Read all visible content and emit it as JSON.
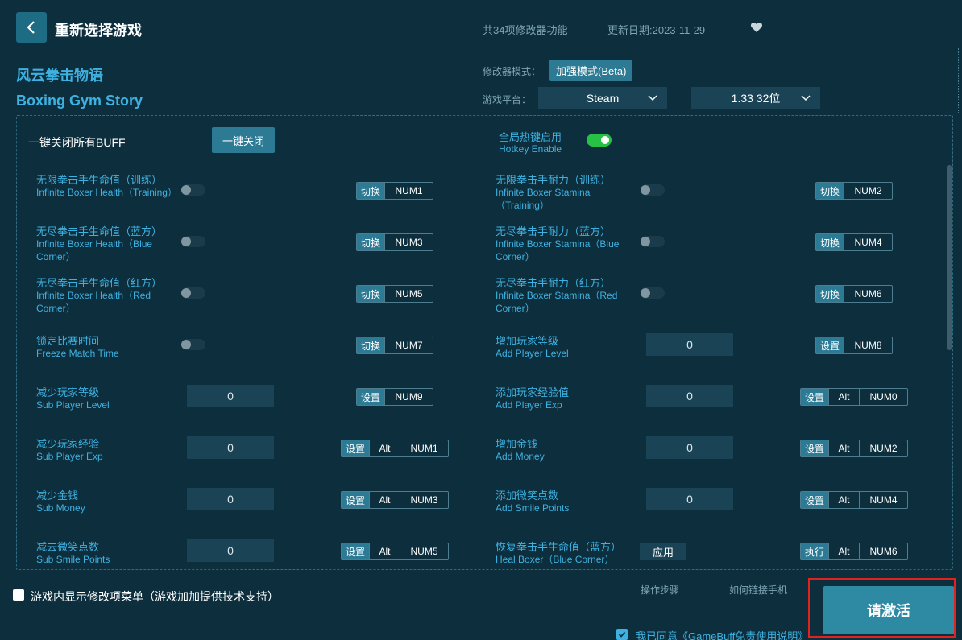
{
  "header": {
    "title": "重新选择游戏",
    "feature_count": "共34项修改器功能",
    "update_date": "更新日期:2023-11-29"
  },
  "game": {
    "name_cn": "风云拳击物语",
    "name_en": "Boxing Gym Story"
  },
  "settings": {
    "mode_label": "修改器模式：",
    "mode_value": "加强模式(Beta)",
    "platform_label": "游戏平台：",
    "platform_value": "Steam",
    "version_value": "1.33 32位"
  },
  "global": {
    "buff_label": "一键关闭所有BUFF",
    "close_all_label": "一键关闭",
    "hotkey_cn": "全局热键启用",
    "hotkey_en": "Hotkey Enable"
  },
  "items": [
    {
      "cn": "无限拳击手生命值（训练）",
      "en": "Infinite Boxer Health（Training）",
      "action": "切换",
      "keys": [
        "NUM1"
      ],
      "value": ""
    },
    {
      "cn": "无限拳击手耐力（训练）",
      "en": "Infinite Boxer Stamina（Training）",
      "action": "切换",
      "keys": [
        "NUM2"
      ],
      "value": ""
    },
    {
      "cn": "无尽拳击手生命值（蓝方）",
      "en": "Infinite Boxer Health（Blue Corner）",
      "action": "切换",
      "keys": [
        "NUM3"
      ],
      "value": ""
    },
    {
      "cn": "无尽拳击手耐力（蓝方）",
      "en": "Infinite Boxer Stamina（Blue Corner）",
      "action": "切换",
      "keys": [
        "NUM4"
      ],
      "value": ""
    },
    {
      "cn": "无尽拳击手生命值（红方）",
      "en": "Infinite Boxer Health（Red Corner）",
      "action": "切换",
      "keys": [
        "NUM5"
      ],
      "value": ""
    },
    {
      "cn": "无尽拳击手耐力（红方）",
      "en": "Infinite Boxer Stamina（Red Corner）",
      "action": "切换",
      "keys": [
        "NUM6"
      ],
      "value": ""
    },
    {
      "cn": "锁定比赛时间",
      "en": "Freeze Match Time",
      "action": "切换",
      "keys": [
        "NUM7"
      ],
      "value": ""
    },
    {
      "cn": "增加玩家等级",
      "en": "Add Player Level",
      "action": "设置",
      "keys": [
        "NUM8"
      ],
      "value": "0"
    },
    {
      "cn": "减少玩家等级",
      "en": "Sub Player Level",
      "action": "设置",
      "keys": [
        "NUM9"
      ],
      "value": "0"
    },
    {
      "cn": "添加玩家经验值",
      "en": "Add Player Exp",
      "action": "设置",
      "keys": [
        "Alt",
        "NUM0"
      ],
      "value": "0"
    },
    {
      "cn": "减少玩家经验",
      "en": "Sub Player Exp",
      "action": "设置",
      "keys": [
        "Alt",
        "NUM1"
      ],
      "value": "0"
    },
    {
      "cn": "增加金钱",
      "en": "Add Money",
      "action": "设置",
      "keys": [
        "Alt",
        "NUM2"
      ],
      "value": "0"
    },
    {
      "cn": "减少金钱",
      "en": "Sub Money",
      "action": "设置",
      "keys": [
        "Alt",
        "NUM3"
      ],
      "value": "0"
    },
    {
      "cn": "添加微笑点数",
      "en": "Add Smile Points",
      "action": "设置",
      "keys": [
        "Alt",
        "NUM4"
      ],
      "value": "0"
    },
    {
      "cn": "减去微笑点数",
      "en": "Sub Smile Points",
      "action": "设置",
      "keys": [
        "Alt",
        "NUM5"
      ],
      "value": "0"
    },
    {
      "cn": "恢复拳击手生命值（蓝方）",
      "en": "Heal Boxer（Blue Corner）",
      "action": "执行",
      "keys": [
        "Alt",
        "NUM6"
      ],
      "value": "",
      "apply_label": "应用"
    }
  ],
  "footer": {
    "menu_label": "游戏内显示修改项菜单（游戏加加提供技术支持）",
    "steps_link": "操作步骤",
    "phone_link": "如何链接手机",
    "activate_label": "请激活",
    "agree_text": "我已同意《GameBuff免责使用说明》"
  },
  "colors": {
    "background": "#0d2e3d",
    "accent": "#3fb1e0",
    "button": "#2d7a94",
    "toggle_on": "#27c146",
    "highlight_border": "#e0231e"
  }
}
